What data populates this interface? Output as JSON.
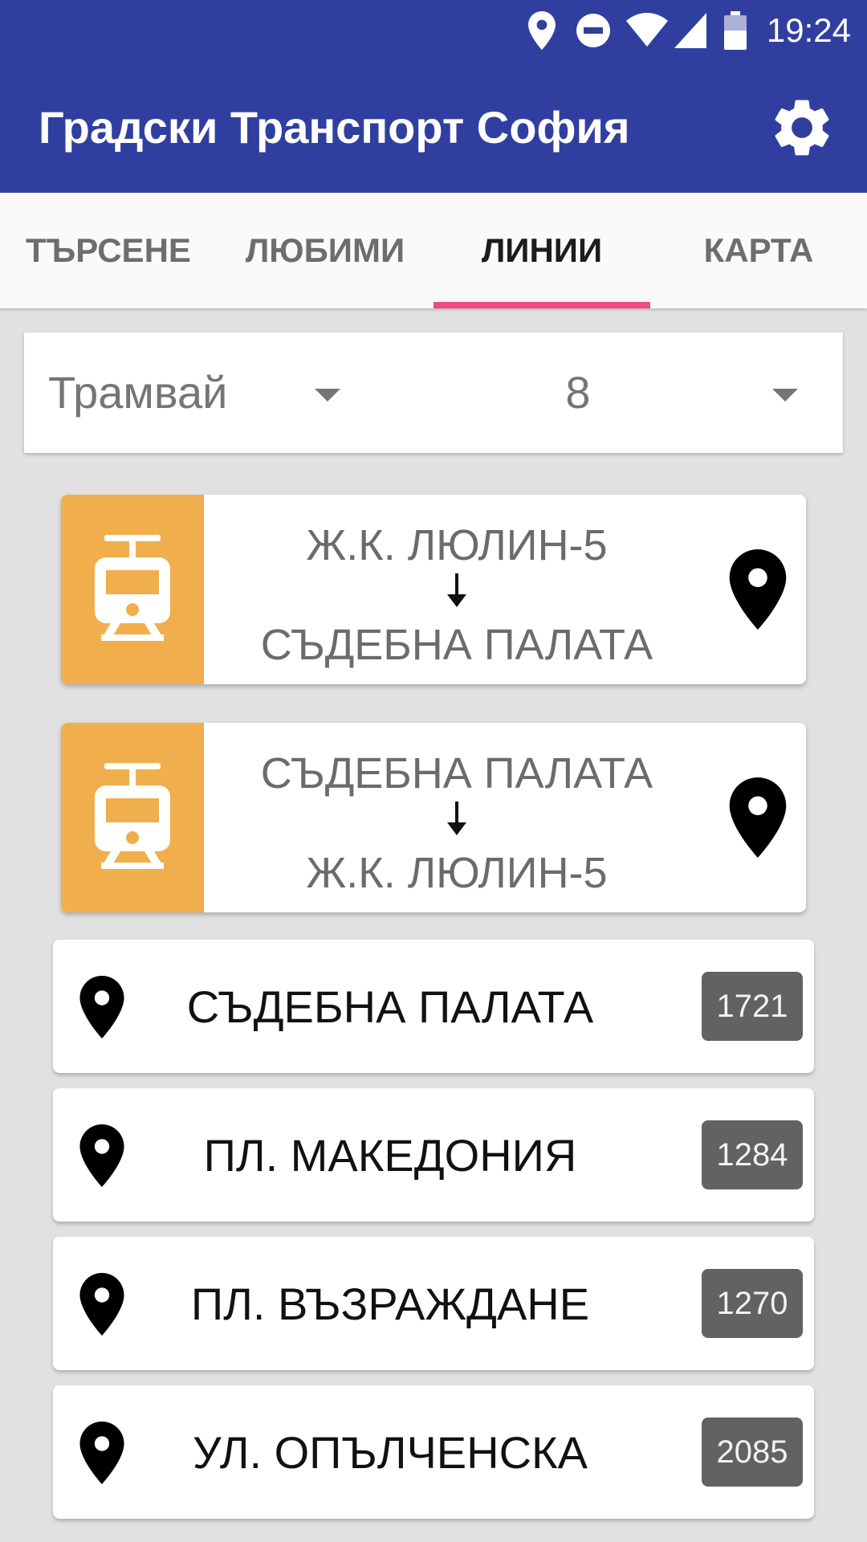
{
  "status_bar": {
    "time": "19:24",
    "icons": [
      "location-icon",
      "do-not-disturb-icon",
      "wifi-icon",
      "cell-signal-icon",
      "battery-icon"
    ]
  },
  "app_bar": {
    "title": "Градски Транспорт София",
    "settings_icon": "gear-icon"
  },
  "tabs": [
    {
      "label": "ТЪРСЕНЕ",
      "active": false
    },
    {
      "label": "ЛЮБИМИ",
      "active": false
    },
    {
      "label": "ЛИНИИ",
      "active": true
    },
    {
      "label": "КАРТА",
      "active": false
    }
  ],
  "selector": {
    "transport_type": "Трамвай",
    "line_number": "8"
  },
  "directions": [
    {
      "from": "Ж.К. ЛЮЛИН-5",
      "to": "СЪДЕБНА ПАЛАТА"
    },
    {
      "from": "СЪДЕБНА ПАЛАТА",
      "to": "Ж.К. ЛЮЛИН-5"
    }
  ],
  "stops": [
    {
      "name": "СЪДЕБНА ПАЛАТА",
      "code": "1721"
    },
    {
      "name": "ПЛ. МАКЕДОНИЯ",
      "code": "1284"
    },
    {
      "name": "ПЛ. ВЪЗРАЖДАНЕ",
      "code": "1270"
    },
    {
      "name": "УЛ. ОПЪЛЧЕНСКА",
      "code": "2085"
    }
  ],
  "colors": {
    "primary": "#303f9f",
    "accent": "#ef4b7d",
    "tram": "#f0ae4d",
    "code_badge": "#626262"
  }
}
